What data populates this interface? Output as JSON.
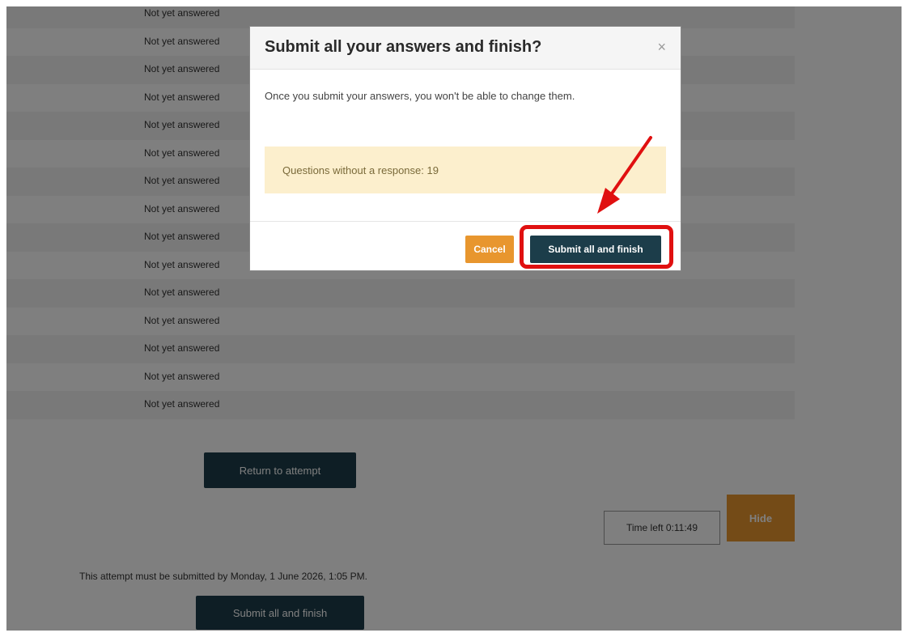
{
  "summary": {
    "rows": [
      {
        "state": "Not yet answered"
      },
      {
        "state": "Not yet answered"
      },
      {
        "state": "Not yet answered"
      },
      {
        "state": "Not yet answered"
      },
      {
        "state": "Not yet answered"
      },
      {
        "state": "Not yet answered"
      },
      {
        "state": "Not yet answered"
      },
      {
        "state": "Not yet answered"
      },
      {
        "state": "Not yet answered"
      },
      {
        "state": "Not yet answered"
      },
      {
        "state": "Not yet answered"
      },
      {
        "state": "Not yet answered"
      },
      {
        "state": "Not yet answered"
      },
      {
        "state": "Not yet answered"
      },
      {
        "state": "Not yet answered"
      }
    ]
  },
  "return_button": "Return to attempt",
  "timer": {
    "text": "Time left 0:11:49",
    "hide_label": "Hide"
  },
  "deadline_text": "This attempt must be submitted by Monday, 1 June 2026, 1:05 PM.",
  "submit_button": "Submit all and finish",
  "modal": {
    "title": "Submit all your answers and finish?",
    "close_symbol": "×",
    "body": "Once you submit your answers, you won't be able to change them.",
    "warning": "Questions without a response: 19",
    "cancel_label": "Cancel",
    "submit_label": "Submit all and finish"
  },
  "colors": {
    "primary": "#1c3d4a",
    "accent": "#e8962e",
    "warning_bg": "#fcefcd",
    "annotation_red": "#e01010"
  }
}
